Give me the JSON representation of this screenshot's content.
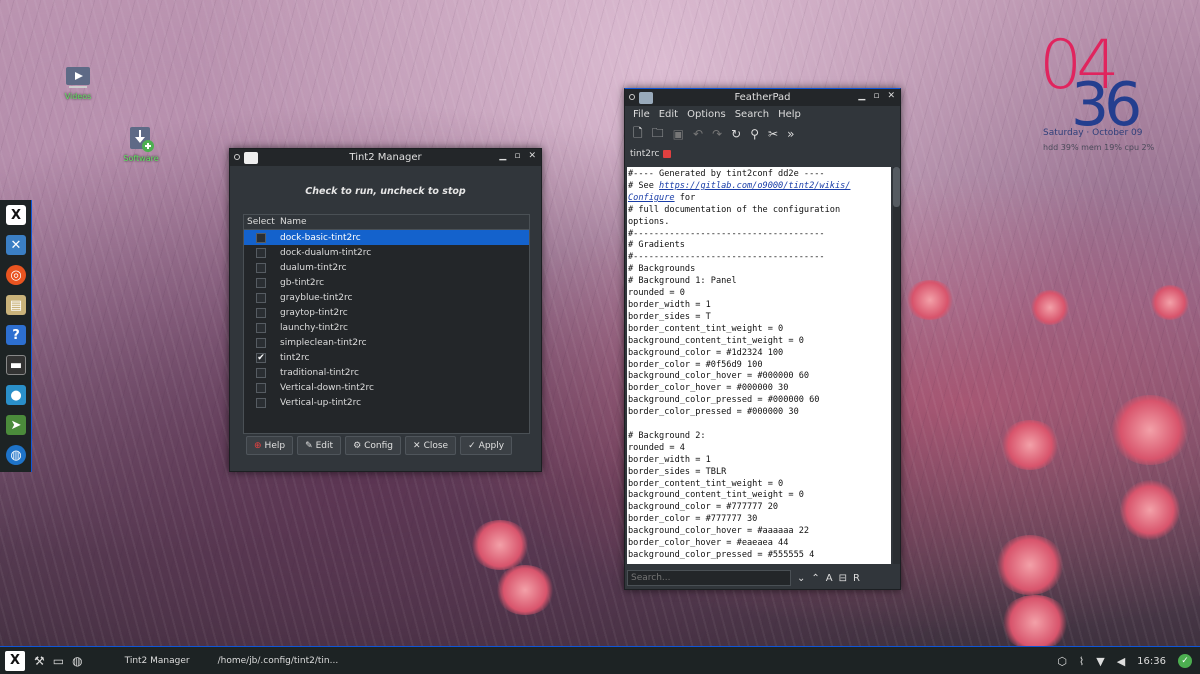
{
  "desktop": {
    "icons": [
      {
        "label": "Videos",
        "icon": "video-folder-icon"
      },
      {
        "label": "Software",
        "icon": "software-install-icon"
      }
    ]
  },
  "clock": {
    "hours": "04",
    "minutes": "36",
    "date": "Saturday · October 09",
    "stats": "hdd 39%  mem 19%  cpu   2%"
  },
  "dock": {
    "items": [
      "x-logo-icon",
      "tools-icon",
      "ubuntu-icon",
      "files-icon",
      "help-icon",
      "terminal-icon",
      "camera-icon",
      "arrow-icon",
      "globe-icon"
    ]
  },
  "tint2": {
    "title": "Tint2 Manager",
    "hint": "Check to run, uncheck to stop",
    "columns": {
      "select": "Select",
      "name": "Name"
    },
    "rows": [
      {
        "name": "dock-basic-tint2rc",
        "checked": "",
        "selected": true
      },
      {
        "name": "dock-dualum-tint2rc",
        "checked": ""
      },
      {
        "name": "dualum-tint2rc",
        "checked": ""
      },
      {
        "name": "gb-tint2rc",
        "checked": ""
      },
      {
        "name": "grayblue-tint2rc",
        "checked": ""
      },
      {
        "name": "graytop-tint2rc",
        "checked": ""
      },
      {
        "name": "launchy-tint2rc",
        "checked": ""
      },
      {
        "name": "simpleclean-tint2rc",
        "checked": ""
      },
      {
        "name": "tint2rc",
        "checked": "✔"
      },
      {
        "name": "traditional-tint2rc",
        "checked": ""
      },
      {
        "name": "Vertical-down-tint2rc",
        "checked": ""
      },
      {
        "name": "Vertical-up-tint2rc",
        "checked": ""
      }
    ],
    "buttons": {
      "help": "Help",
      "edit": "Edit",
      "config": "Config",
      "close": "Close",
      "apply": "Apply"
    }
  },
  "featherpad": {
    "title": "FeatherPad",
    "menu": {
      "file": "File",
      "edit": "Edit",
      "options": "Options",
      "search": "Search",
      "help": "Help"
    },
    "tab": "tint2rc",
    "link": "https://gitlab.com/o9000/tint2/wikis/Configure",
    "lines": {
      "l1": "#---- Generated by tint2conf dd2e ----",
      "l2a": "# See ",
      "l2b": "https://gitlab.com/o9000/tint2/wikis/",
      "l3a": "Configure",
      "l3b": " for",
      "rest": "# full documentation of the configuration\noptions.\n#-------------------------------------\n# Gradients\n#-------------------------------------\n# Backgrounds\n# Background 1: Panel\nrounded = 0\nborder_width = 1\nborder_sides = T\nborder_content_tint_weight = 0\nbackground_content_tint_weight = 0\nbackground_color = #1d2324 100\nborder_color = #0f56d9 100\nbackground_color_hover = #000000 60\nborder_color_hover = #000000 30\nbackground_color_pressed = #000000 60\nborder_color_pressed = #000000 30\n\n# Background 2:\nrounded = 4\nborder_width = 1\nborder_sides = TBLR\nborder_content_tint_weight = 0\nbackground_content_tint_weight = 0\nbackground_color = #777777 20\nborder_color = #777777 30\nbackground_color_hover = #aaaaaa 22\nborder_color_hover = #eaeaea 44\nbackground_color_pressed = #555555 4"
    },
    "search_placeholder": "Search..."
  },
  "taskbar": {
    "tasks": [
      "Tint2 Manager",
      "/home/jb/.config/tint2/tin..."
    ],
    "time": "16:36"
  },
  "colors": {
    "panel": "#1d2324",
    "accent": "#0f56d9",
    "selection": "#1462cc"
  }
}
